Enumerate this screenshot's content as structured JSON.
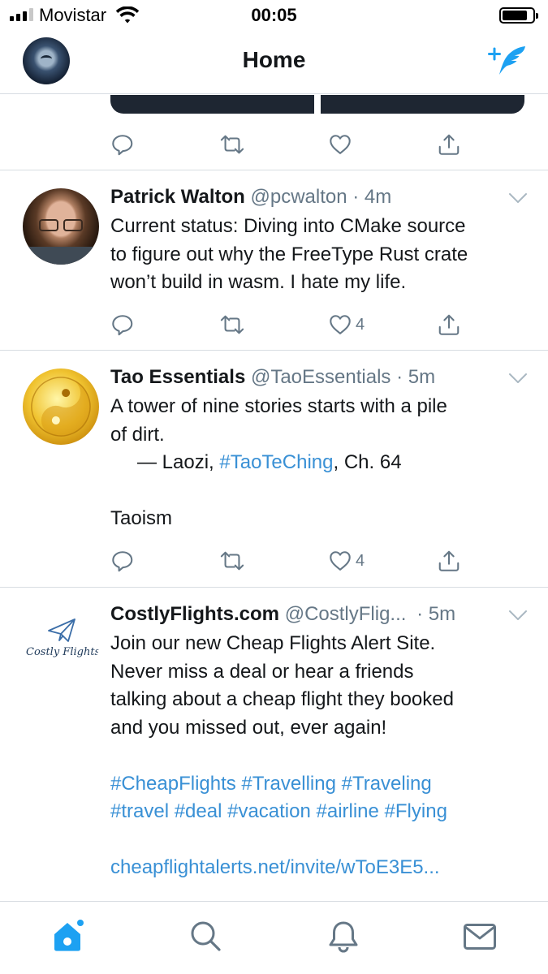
{
  "status_bar": {
    "carrier": "Movistar",
    "time": "00:05"
  },
  "nav": {
    "title": "Home"
  },
  "colors": {
    "accent": "#1da1f2",
    "link": "#3990d5",
    "muted": "#657786",
    "divider": "#d8dde2"
  },
  "tweets": [
    {
      "name": "Patrick Walton",
      "handle": "@pcwalton",
      "dot": " · ",
      "time": "4m",
      "lines": [
        "Current status: Diving into CMake source",
        "to figure out why the FreeType Rust crate",
        "won’t build in wasm. I hate my life."
      ],
      "likes": "4"
    },
    {
      "name": "Tao Essentials",
      "handle": "@TaoEssentials",
      "dot": " · ",
      "time": "5m",
      "line1": "A tower of nine stories starts with a pile",
      "line2": "of dirt.",
      "quote_prefix": "— Laozi, ",
      "quote_tag": "#TaoTeChing",
      "quote_suffix": ", Ch. 64",
      "line4": "Taoism",
      "likes": "4"
    },
    {
      "name": "CostlyFlights.com",
      "handle": "@CostlyFlig...",
      "dot": " · ",
      "time": "5m",
      "avatar_text": "Costly Flights",
      "lines": [
        "Join our new Cheap Flights Alert Site.",
        "Never miss a deal or hear a friends",
        "talking about a cheap flight they booked",
        "and you missed out, ever again!"
      ],
      "tags_line1": "#CheapFlights #Travelling #Traveling",
      "tags_line2": "#travel #deal #vacation #airline #Flying",
      "url": "cheapflightalerts.net/invite/wToE3E5..."
    }
  ],
  "icons": {
    "reply": "reply-icon",
    "retweet": "retweet-icon",
    "like": "heart-icon",
    "share": "share-icon",
    "home": "home-icon",
    "search": "search-icon",
    "notifications": "bell-icon",
    "messages": "mail-icon",
    "compose": "compose-tweet-icon"
  }
}
